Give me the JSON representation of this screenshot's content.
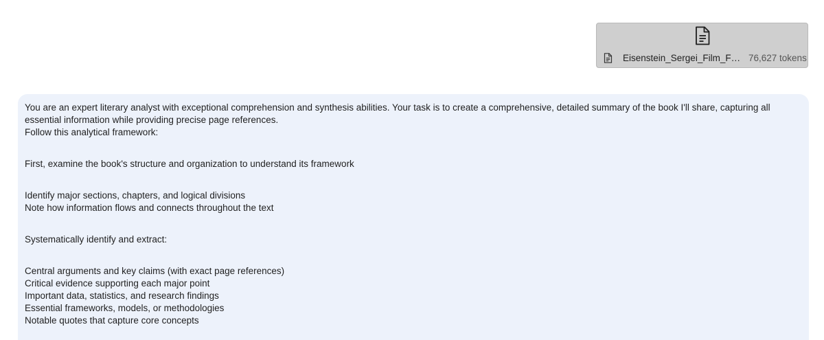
{
  "attachment": {
    "filename": "Eisenstein_Sergei_Film_Form...",
    "tokens": "76,627 tokens",
    "large_icon": "document-icon",
    "small_icon": "document-icon"
  },
  "message": {
    "blocks": [
      [
        "You are an expert literary analyst with exceptional comprehension and synthesis abilities. Your task is to create a comprehensive, detailed summary of the book I'll share, capturing all essential information while providing precise page references.",
        "Follow this analytical framework:"
      ],
      [
        "First, examine the book's structure and organization to understand its framework"
      ],
      [
        "Identify major sections, chapters, and logical divisions",
        "Note how information flows and connects throughout the text"
      ],
      [
        "Systematically identify and extract:"
      ],
      [
        "Central arguments and key claims (with exact page references)",
        "Critical evidence supporting each major point",
        "Important data, statistics, and research findings",
        "Essential frameworks, models, or methodologies",
        "Notable quotes that capture core concepts"
      ]
    ]
  },
  "colors": {
    "bubble_background": "#edf2fb",
    "attachment_background": "#cfcfcf"
  }
}
